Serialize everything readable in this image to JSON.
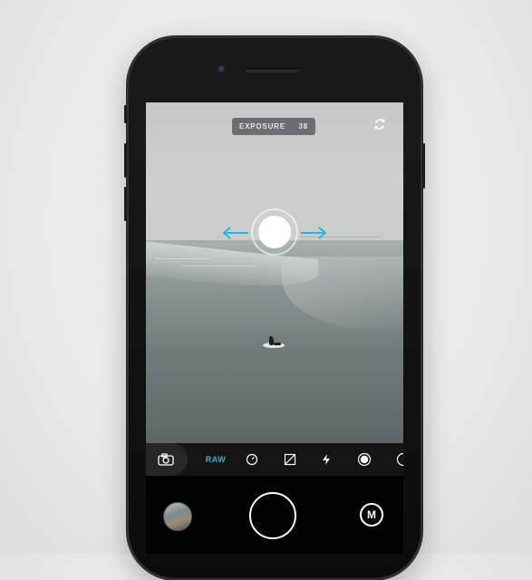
{
  "exposure": {
    "label": "EXPOSURE",
    "value": "38"
  },
  "toolbar": {
    "raw_label": "RAW"
  },
  "mode": {
    "label": "M"
  },
  "colors": {
    "accent": "#2fb4d8",
    "toolbar_bg": "#141414",
    "pill_bg": "#5a5f64"
  },
  "icons": {
    "rotate": "rotate-camera-icon",
    "camera": "camera-icon",
    "timer": "timer-icon",
    "exposure_comp": "exposure-compensation-icon",
    "flash": "flash-icon",
    "white_balance": "white-balance-icon",
    "more": "more-tools-icon"
  }
}
